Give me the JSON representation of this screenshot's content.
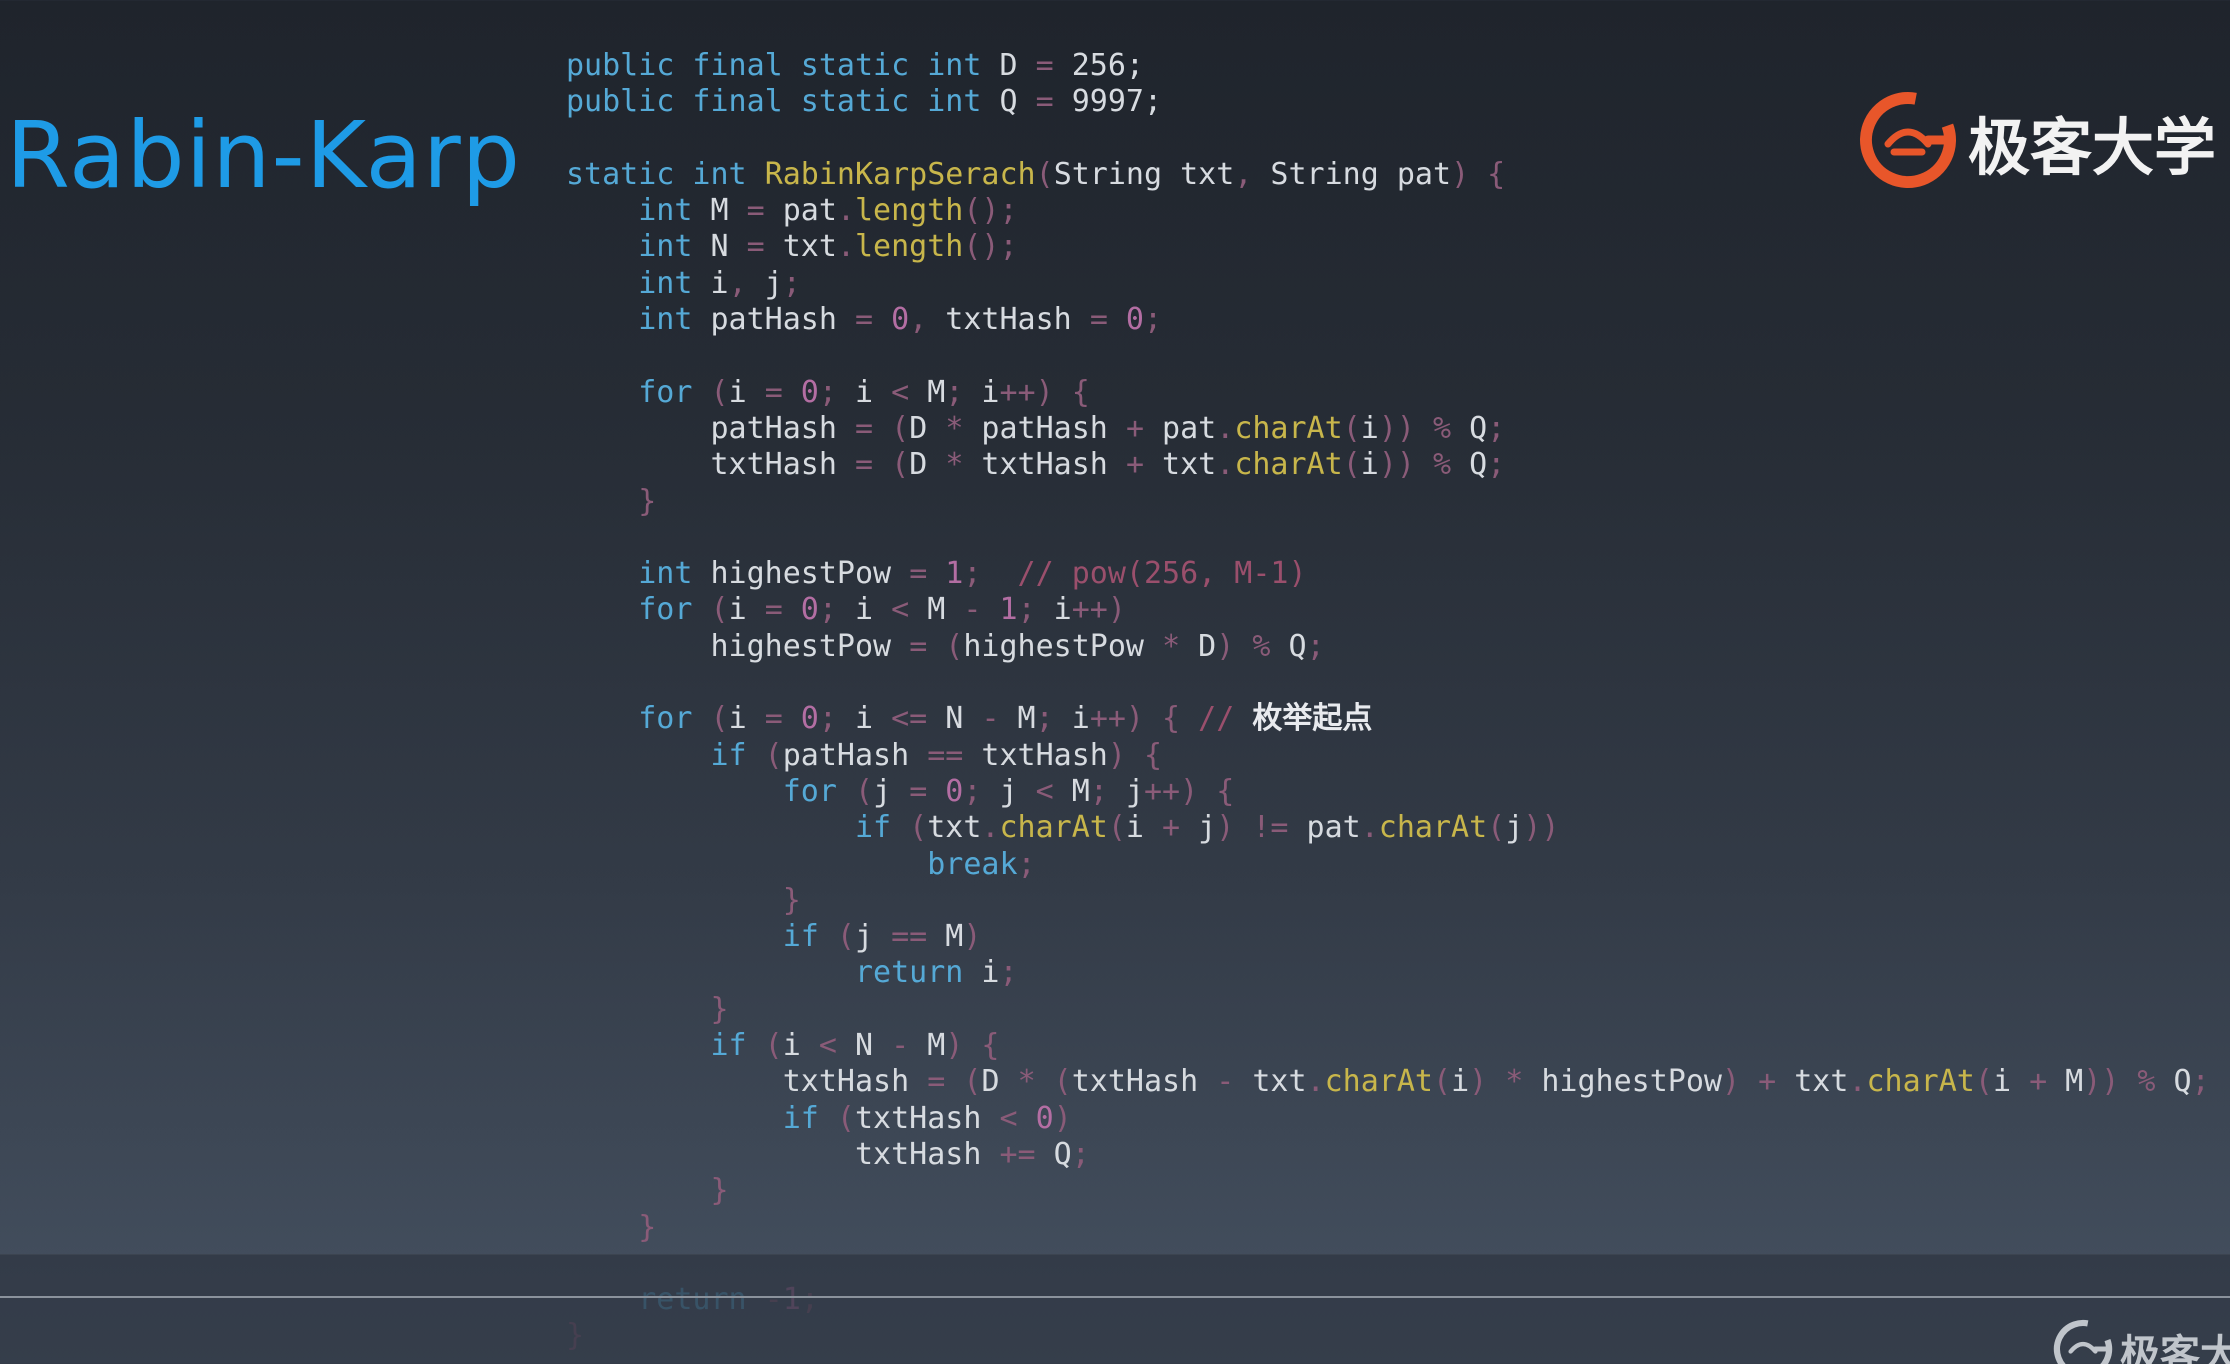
{
  "slide": {
    "title": "Rabin-Karp"
  },
  "brand": {
    "name": "极客大学",
    "watermark_name": "极客大",
    "accent_color": "#e8562a",
    "title_color": "#1e9be6"
  },
  "code": {
    "language": "java",
    "lines": [
      {
        "indent": 0,
        "tokens": [
          [
            "kw",
            "public final static int"
          ],
          [
            "id",
            " D "
          ],
          [
            "op",
            "="
          ],
          [
            "id",
            " 256;"
          ]
        ]
      },
      {
        "indent": 0,
        "tokens": [
          [
            "kw",
            "public final static int"
          ],
          [
            "id",
            " Q "
          ],
          [
            "op",
            "="
          ],
          [
            "id",
            " 9997;"
          ]
        ]
      },
      {
        "indent": 0,
        "tokens": []
      },
      {
        "indent": 0,
        "tokens": [
          [
            "kw",
            "static int "
          ],
          [
            "fn",
            "RabinKarpSerach"
          ],
          [
            "op",
            "("
          ],
          [
            "id",
            "String txt"
          ],
          [
            "op",
            ","
          ],
          [
            "id",
            " String pat"
          ],
          [
            "op",
            ") {"
          ]
        ]
      },
      {
        "indent": 1,
        "tokens": [
          [
            "kw",
            "int"
          ],
          [
            "id",
            " M "
          ],
          [
            "op",
            "="
          ],
          [
            "id",
            " pat"
          ],
          [
            "op",
            "."
          ],
          [
            "fn",
            "length"
          ],
          [
            "op",
            "();"
          ]
        ]
      },
      {
        "indent": 1,
        "tokens": [
          [
            "kw",
            "int"
          ],
          [
            "id",
            " N "
          ],
          [
            "op",
            "="
          ],
          [
            "id",
            " txt"
          ],
          [
            "op",
            "."
          ],
          [
            "fn",
            "length"
          ],
          [
            "op",
            "();"
          ]
        ]
      },
      {
        "indent": 1,
        "tokens": [
          [
            "kw",
            "int"
          ],
          [
            "id",
            " i"
          ],
          [
            "op",
            ","
          ],
          [
            "id",
            " j"
          ],
          [
            "op",
            ";"
          ]
        ]
      },
      {
        "indent": 1,
        "tokens": [
          [
            "kw",
            "int"
          ],
          [
            "id",
            " patHash "
          ],
          [
            "op",
            "="
          ],
          [
            "num",
            " 0"
          ],
          [
            "op",
            ","
          ],
          [
            "id",
            " txtHash "
          ],
          [
            "op",
            "="
          ],
          [
            "num",
            " 0"
          ],
          [
            "op",
            ";"
          ]
        ]
      },
      {
        "indent": 0,
        "tokens": []
      },
      {
        "indent": 1,
        "tokens": [
          [
            "kw",
            "for"
          ],
          [
            "op",
            " ("
          ],
          [
            "id",
            "i "
          ],
          [
            "op",
            "="
          ],
          [
            "num",
            " 0"
          ],
          [
            "op",
            ";"
          ],
          [
            "id",
            " i "
          ],
          [
            "op",
            "<"
          ],
          [
            "id",
            " M"
          ],
          [
            "op",
            ";"
          ],
          [
            "id",
            " i"
          ],
          [
            "op",
            "++) {"
          ]
        ]
      },
      {
        "indent": 2,
        "tokens": [
          [
            "id",
            "patHash "
          ],
          [
            "op",
            "= ("
          ],
          [
            "id",
            "D "
          ],
          [
            "op",
            "*"
          ],
          [
            "id",
            " patHash "
          ],
          [
            "op",
            "+"
          ],
          [
            "id",
            " pat"
          ],
          [
            "op",
            "."
          ],
          [
            "fn",
            "charAt"
          ],
          [
            "op",
            "("
          ],
          [
            "id",
            "i"
          ],
          [
            "op",
            ")) %"
          ],
          [
            "id",
            " Q"
          ],
          [
            "op",
            ";"
          ]
        ]
      },
      {
        "indent": 2,
        "tokens": [
          [
            "id",
            "txtHash "
          ],
          [
            "op",
            "= ("
          ],
          [
            "id",
            "D "
          ],
          [
            "op",
            "*"
          ],
          [
            "id",
            " txtHash "
          ],
          [
            "op",
            "+"
          ],
          [
            "id",
            " txt"
          ],
          [
            "op",
            "."
          ],
          [
            "fn",
            "charAt"
          ],
          [
            "op",
            "("
          ],
          [
            "id",
            "i"
          ],
          [
            "op",
            ")) %"
          ],
          [
            "id",
            " Q"
          ],
          [
            "op",
            ";"
          ]
        ]
      },
      {
        "indent": 1,
        "tokens": [
          [
            "op",
            "}"
          ]
        ]
      },
      {
        "indent": 0,
        "tokens": []
      },
      {
        "indent": 1,
        "tokens": [
          [
            "kw",
            "int"
          ],
          [
            "id",
            " highestPow "
          ],
          [
            "op",
            "="
          ],
          [
            "num",
            " 1"
          ],
          [
            "op",
            ";"
          ],
          [
            "cm",
            "  // pow(256, M-1)"
          ]
        ]
      },
      {
        "indent": 1,
        "tokens": [
          [
            "kw",
            "for"
          ],
          [
            "op",
            " ("
          ],
          [
            "id",
            "i "
          ],
          [
            "op",
            "="
          ],
          [
            "num",
            " 0"
          ],
          [
            "op",
            ";"
          ],
          [
            "id",
            " i "
          ],
          [
            "op",
            "<"
          ],
          [
            "id",
            " M "
          ],
          [
            "op",
            "-"
          ],
          [
            "num",
            " 1"
          ],
          [
            "op",
            ";"
          ],
          [
            "id",
            " i"
          ],
          [
            "op",
            "++)"
          ]
        ]
      },
      {
        "indent": 2,
        "tokens": [
          [
            "id",
            "highestPow "
          ],
          [
            "op",
            "= ("
          ],
          [
            "id",
            "highestPow "
          ],
          [
            "op",
            "*"
          ],
          [
            "id",
            " D"
          ],
          [
            "op",
            ") %"
          ],
          [
            "id",
            " Q"
          ],
          [
            "op",
            ";"
          ]
        ]
      },
      {
        "indent": 0,
        "tokens": []
      },
      {
        "indent": 1,
        "tokens": [
          [
            "kw",
            "for"
          ],
          [
            "op",
            " ("
          ],
          [
            "id",
            "i "
          ],
          [
            "op",
            "="
          ],
          [
            "num",
            " 0"
          ],
          [
            "op",
            ";"
          ],
          [
            "id",
            " i "
          ],
          [
            "op",
            "<="
          ],
          [
            "id",
            " N "
          ],
          [
            "op",
            "-"
          ],
          [
            "id",
            " M"
          ],
          [
            "op",
            ";"
          ],
          [
            "id",
            " i"
          ],
          [
            "op",
            "++) {"
          ],
          [
            "cm",
            " // "
          ],
          [
            "cn",
            "枚举起点"
          ]
        ]
      },
      {
        "indent": 2,
        "tokens": [
          [
            "kw",
            "if"
          ],
          [
            "op",
            " ("
          ],
          [
            "id",
            "patHash "
          ],
          [
            "op",
            "=="
          ],
          [
            "id",
            " txtHash"
          ],
          [
            "op",
            ") {"
          ]
        ]
      },
      {
        "indent": 3,
        "tokens": [
          [
            "kw",
            "for"
          ],
          [
            "op",
            " ("
          ],
          [
            "id",
            "j "
          ],
          [
            "op",
            "="
          ],
          [
            "num",
            " 0"
          ],
          [
            "op",
            ";"
          ],
          [
            "id",
            " j "
          ],
          [
            "op",
            "<"
          ],
          [
            "id",
            " M"
          ],
          [
            "op",
            ";"
          ],
          [
            "id",
            " j"
          ],
          [
            "op",
            "++) {"
          ]
        ]
      },
      {
        "indent": 4,
        "tokens": [
          [
            "kw",
            "if"
          ],
          [
            "op",
            " ("
          ],
          [
            "id",
            "txt"
          ],
          [
            "op",
            "."
          ],
          [
            "fn",
            "charAt"
          ],
          [
            "op",
            "("
          ],
          [
            "id",
            "i "
          ],
          [
            "op",
            "+"
          ],
          [
            "id",
            " j"
          ],
          [
            "op",
            ") !="
          ],
          [
            "id",
            " pat"
          ],
          [
            "op",
            "."
          ],
          [
            "fn",
            "charAt"
          ],
          [
            "op",
            "("
          ],
          [
            "id",
            "j"
          ],
          [
            "op",
            "))"
          ]
        ]
      },
      {
        "indent": 5,
        "tokens": [
          [
            "kw",
            "break"
          ],
          [
            "op",
            ";"
          ]
        ]
      },
      {
        "indent": 3,
        "tokens": [
          [
            "op",
            "}"
          ]
        ]
      },
      {
        "indent": 3,
        "tokens": [
          [
            "kw",
            "if"
          ],
          [
            "op",
            " ("
          ],
          [
            "id",
            "j "
          ],
          [
            "op",
            "=="
          ],
          [
            "id",
            " M"
          ],
          [
            "op",
            ")"
          ]
        ]
      },
      {
        "indent": 4,
        "tokens": [
          [
            "kw",
            "return"
          ],
          [
            "id",
            " i"
          ],
          [
            "op",
            ";"
          ]
        ]
      },
      {
        "indent": 2,
        "tokens": [
          [
            "op",
            "}"
          ]
        ]
      },
      {
        "indent": 2,
        "tokens": [
          [
            "kw",
            "if"
          ],
          [
            "op",
            " ("
          ],
          [
            "id",
            "i "
          ],
          [
            "op",
            "<"
          ],
          [
            "id",
            " N "
          ],
          [
            "op",
            "-"
          ],
          [
            "id",
            " M"
          ],
          [
            "op",
            ") {"
          ]
        ]
      },
      {
        "indent": 3,
        "tokens": [
          [
            "id",
            "txtHash "
          ],
          [
            "op",
            "= ("
          ],
          [
            "id",
            "D "
          ],
          [
            "op",
            "* ("
          ],
          [
            "id",
            "txtHash "
          ],
          [
            "op",
            "-"
          ],
          [
            "id",
            " txt"
          ],
          [
            "op",
            "."
          ],
          [
            "fn",
            "charAt"
          ],
          [
            "op",
            "("
          ],
          [
            "id",
            "i"
          ],
          [
            "op",
            ") *"
          ],
          [
            "id",
            " highestPow"
          ],
          [
            "op",
            ") +"
          ],
          [
            "id",
            " txt"
          ],
          [
            "op",
            "."
          ],
          [
            "fn",
            "charAt"
          ],
          [
            "op",
            "("
          ],
          [
            "id",
            "i "
          ],
          [
            "op",
            "+"
          ],
          [
            "id",
            " M"
          ],
          [
            "op",
            ")) %"
          ],
          [
            "id",
            " Q"
          ],
          [
            "op",
            ";"
          ]
        ]
      },
      {
        "indent": 3,
        "tokens": [
          [
            "kw",
            "if"
          ],
          [
            "op",
            " ("
          ],
          [
            "id",
            "txtHash "
          ],
          [
            "op",
            "<"
          ],
          [
            "num",
            " 0"
          ],
          [
            "op",
            ")"
          ]
        ]
      },
      {
        "indent": 4,
        "tokens": [
          [
            "id",
            "txtHash "
          ],
          [
            "op",
            "+="
          ],
          [
            "id",
            " Q"
          ],
          [
            "op",
            ";"
          ]
        ]
      },
      {
        "indent": 2,
        "tokens": [
          [
            "op",
            "}"
          ]
        ]
      },
      {
        "indent": 1,
        "tokens": [
          [
            "op",
            "}"
          ]
        ]
      },
      {
        "indent": 0,
        "tokens": []
      },
      {
        "indent": 1,
        "faded": true,
        "tokens": [
          [
            "kw",
            "return"
          ],
          [
            "op",
            " -"
          ],
          [
            "num",
            "1"
          ],
          [
            "op",
            ";"
          ]
        ]
      },
      {
        "indent": 0,
        "faded": true,
        "tokens": [
          [
            "op",
            "}"
          ]
        ]
      }
    ]
  },
  "icons": {
    "logo": "geek-university-logo-icon",
    "watermark": "geek-university-watermark-icon"
  }
}
